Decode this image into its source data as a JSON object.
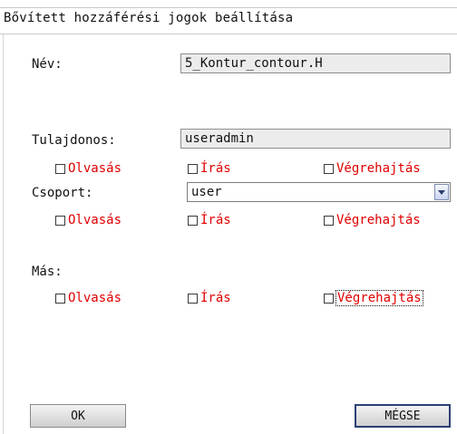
{
  "dialog": {
    "title": "Bővített hozzáférési jogok beállítása"
  },
  "name": {
    "label": "Név:",
    "value": "5_Kontur_contour.H"
  },
  "owner": {
    "label": "Tulajdonos:",
    "value": "useradmin",
    "read": {
      "label": "Olvasás",
      "checked": false
    },
    "write": {
      "label": "Írás",
      "checked": false
    },
    "execute": {
      "label": "Végrehajtás",
      "checked": false
    }
  },
  "group": {
    "label": "Csoport:",
    "value": "user",
    "read": {
      "label": "Olvasás",
      "checked": false
    },
    "write": {
      "label": "Írás",
      "checked": false
    },
    "execute": {
      "label": "Végrehajtás",
      "checked": false
    }
  },
  "others": {
    "label": "Más:",
    "read": {
      "label": "Olvasás",
      "checked": false
    },
    "write": {
      "label": "Írás",
      "checked": false
    },
    "execute": {
      "label": "Végrehajtás",
      "checked": false,
      "focused": true
    }
  },
  "buttons": {
    "ok": "OK",
    "cancel": "MÉGSE"
  },
  "colors": {
    "permission_text": "#e00000",
    "field_background": "#ececec"
  }
}
